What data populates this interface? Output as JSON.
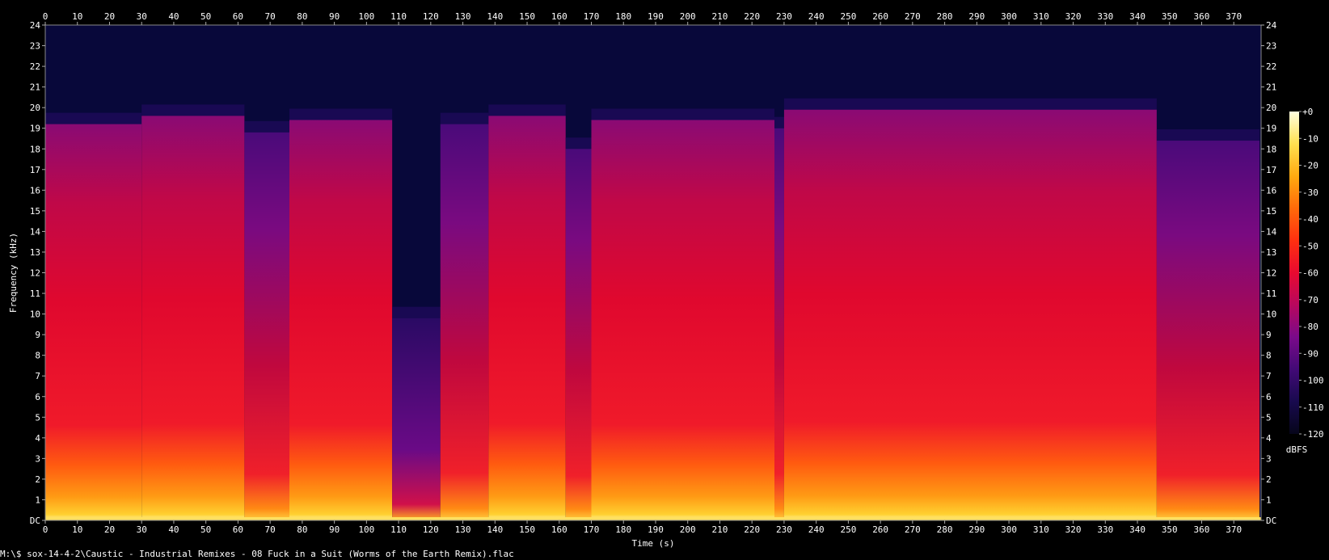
{
  "chart_data": {
    "type": "heatmap",
    "subtype": "spectrogram",
    "xlabel": "Time (s)",
    "ylabel": "Frequency (kHz)",
    "xlim": [
      0,
      378.5
    ],
    "ylim": [
      0,
      24
    ],
    "x_ticks": [
      "0",
      "10",
      "20",
      "30",
      "40",
      "50",
      "60",
      "70",
      "80",
      "90",
      "100",
      "110",
      "120",
      "130",
      "140",
      "150",
      "160",
      "170",
      "180",
      "190",
      "200",
      "210",
      "220",
      "230",
      "240",
      "250",
      "260",
      "270",
      "280",
      "290",
      "300",
      "310",
      "320",
      "330",
      "340",
      "350",
      "360",
      "370"
    ],
    "y_ticks": [
      "DC",
      "1",
      "2",
      "3",
      "4",
      "5",
      "6",
      "7",
      "8",
      "9",
      "10",
      "11",
      "12",
      "13",
      "14",
      "15",
      "16",
      "17",
      "18",
      "19",
      "20",
      "21",
      "22",
      "23",
      "24"
    ],
    "colorbar": {
      "label": "dBFS",
      "range": [
        -120,
        0
      ],
      "ticks": [
        "+0",
        "-10",
        "-20",
        "-30",
        "-40",
        "-50",
        "-60",
        "-70",
        "-80",
        "-90",
        "-100",
        "-110",
        "-120"
      ],
      "colors": [
        "#06051a",
        "#180a4e",
        "#420a76",
        "#7a0a8a",
        "#b8085e",
        "#e80a30",
        "#ff3010",
        "#ff6a0a",
        "#ffaa10",
        "#ffe050",
        "#ffffe0"
      ]
    },
    "segments": [
      {
        "t0": 0,
        "t1": 30,
        "level": "loud",
        "cutoff_khz": 19.2
      },
      {
        "t0": 30,
        "t1": 62,
        "level": "loud",
        "cutoff_khz": 19.6
      },
      {
        "t0": 62,
        "t1": 76,
        "level": "mid",
        "cutoff_khz": 18.8
      },
      {
        "t0": 76,
        "t1": 108,
        "level": "loud",
        "cutoff_khz": 19.4
      },
      {
        "t0": 108,
        "t1": 123,
        "level": "quiet",
        "cutoff_khz": 9.8
      },
      {
        "t0": 123,
        "t1": 138,
        "level": "mid",
        "cutoff_khz": 19.2
      },
      {
        "t0": 138,
        "t1": 162,
        "level": "loud",
        "cutoff_khz": 19.6
      },
      {
        "t0": 162,
        "t1": 170,
        "level": "mid",
        "cutoff_khz": 18.0
      },
      {
        "t0": 170,
        "t1": 227,
        "level": "loud",
        "cutoff_khz": 19.4
      },
      {
        "t0": 227,
        "t1": 230,
        "level": "mid",
        "cutoff_khz": 19.0
      },
      {
        "t0": 230,
        "t1": 346,
        "level": "loud",
        "cutoff_khz": 19.9
      },
      {
        "t0": 346,
        "t1": 378,
        "level": "mid",
        "cutoff_khz": 18.4
      }
    ]
  },
  "caption": "M:\\$ sox-14-4-2\\Caustic - Industrial Remixes - 08 Fuck in a Suit (Worms of the Earth Remix).flac"
}
